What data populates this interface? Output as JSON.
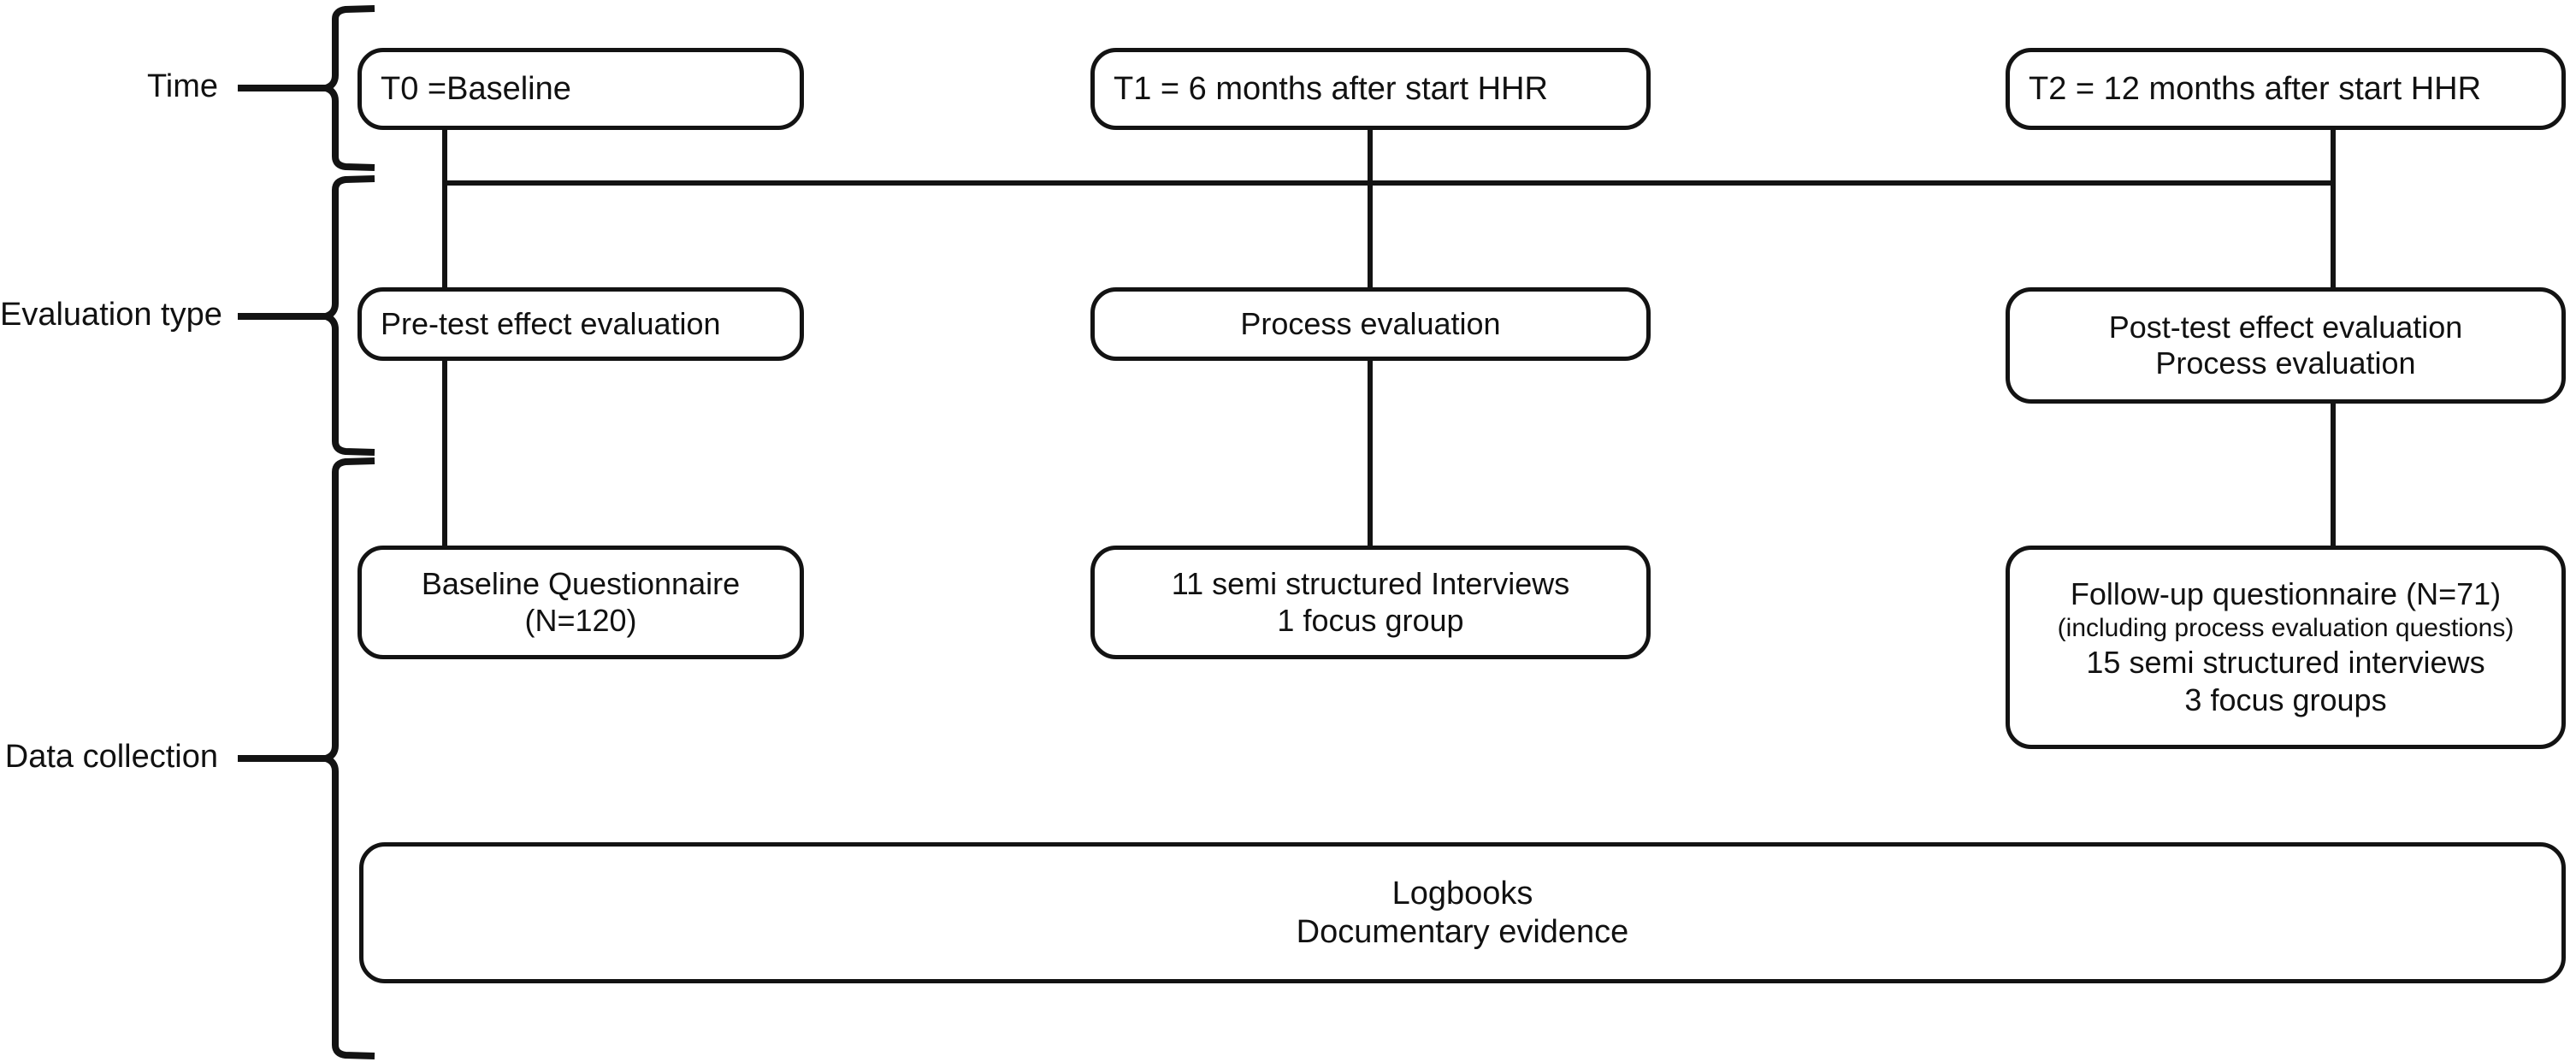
{
  "figure": {
    "type": "study-design-flow-diagram",
    "background_color": "#ffffff",
    "line_color": "#131313",
    "text_color": "#111111"
  },
  "row_labels": [
    {
      "id": "time",
      "label": "Time"
    },
    {
      "id": "evaluation_type",
      "label": "Evaluation type"
    },
    {
      "id": "data_collection",
      "label": "Data collection"
    }
  ],
  "columns": [
    {
      "id": "t0",
      "time_label": "T0 =Baseline"
    },
    {
      "id": "t1",
      "time_label": "T1 = 6 months after start HHR"
    },
    {
      "id": "t2",
      "time_label": "T2 = 12 months after start HHR"
    }
  ],
  "rows": {
    "time": {
      "t0": {
        "lines": [
          "T0 =Baseline"
        ]
      },
      "t1": {
        "lines": [
          "T1 = 6 months after start HHR"
        ]
      },
      "t2": {
        "lines": [
          "T2 = 12 months after start HHR"
        ]
      }
    },
    "evaluation_type": {
      "t0": {
        "lines": [
          "Pre-test effect evaluation"
        ]
      },
      "t1": {
        "lines": [
          "Process evaluation"
        ]
      },
      "t2": {
        "lines": [
          "Post-test effect evaluation",
          "Process evaluation"
        ]
      }
    },
    "data_collection": {
      "t0": {
        "lines": [
          "Baseline Questionnaire",
          "(N=120)"
        ]
      },
      "t1": {
        "lines": [
          "11 semi structured Interviews",
          "1 focus group"
        ]
      },
      "t2": {
        "lines": [
          "Follow-up questionnaire (N=71)",
          "(including process evaluation questions)",
          "15 semi structured interviews",
          "3 focus groups"
        ]
      },
      "full_width": {
        "lines": [
          "Logbooks",
          "Documentary evidence"
        ]
      }
    }
  },
  "node_text": {
    "t0_time": "T0 =Baseline",
    "t1_time": "T1 = 6 months after start HHR",
    "t2_time": "T2 = 12 months after start HHR",
    "t0_eval": "Pre-test effect evaluation",
    "t1_eval": "Process evaluation",
    "t2_eval_line1": "Post-test effect evaluation",
    "t2_eval_line2": "Process evaluation",
    "t0_data_line1": "Baseline Questionnaire",
    "t0_data_line2": "(N=120)",
    "t1_data_line1": "11 semi structured Interviews",
    "t1_data_line2": "1 focus group",
    "t2_data_line1": "Follow-up questionnaire (N=71)",
    "t2_data_line2": "(including process evaluation questions)",
    "t2_data_line3": "15 semi structured interviews",
    "t2_data_line4": "3 focus groups",
    "shared_data_line1": "Logbooks",
    "shared_data_line2": "Documentary evidence"
  }
}
